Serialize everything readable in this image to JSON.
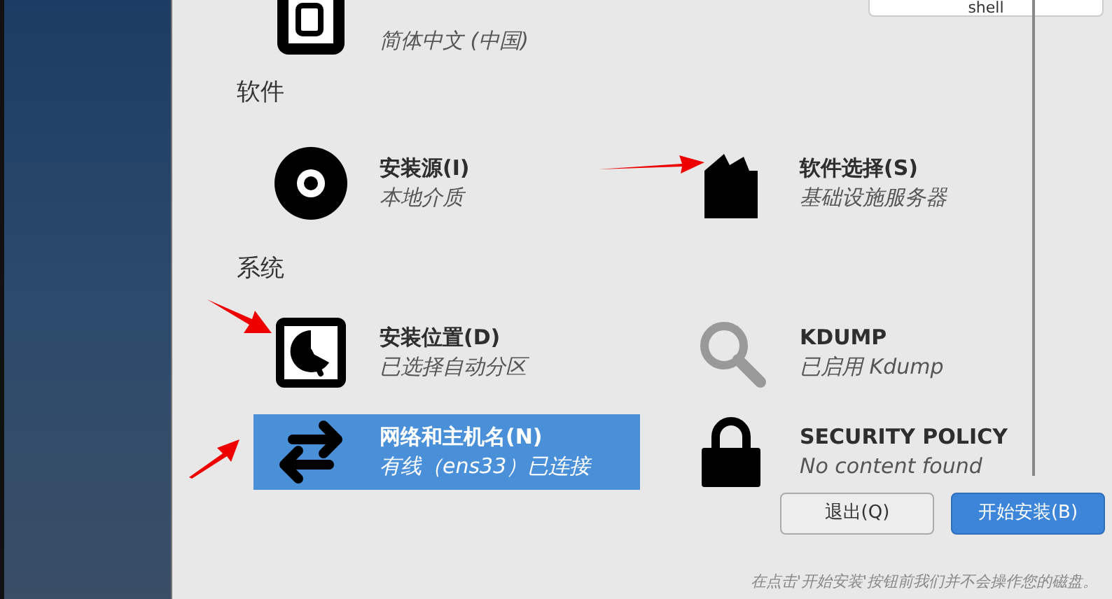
{
  "tooltip": {
    "text": "shell"
  },
  "top_item": {
    "kind": "language",
    "subtitle": "简体中文 (中国)"
  },
  "sections": [
    {
      "title": "软件",
      "items": [
        {
          "kind": "disc",
          "title": "安装源(I)",
          "subtitle": "本地介质",
          "selected": false
        },
        {
          "kind": "package",
          "title": "软件选择(S)",
          "subtitle": "基础设施服务器",
          "selected": false
        }
      ]
    },
    {
      "title": "系统",
      "items": [
        {
          "kind": "disk",
          "title": "安装位置(D)",
          "subtitle": "已选择自动分区",
          "selected": false
        },
        {
          "kind": "search",
          "title": "KDUMP",
          "subtitle": "已启用 Kdump",
          "selected": false
        },
        {
          "kind": "network",
          "title": "网络和主机名(N)",
          "subtitle": "有线（ens33）已连接",
          "selected": true
        },
        {
          "kind": "lock",
          "title": "SECURITY POLICY",
          "subtitle": "No content found",
          "selected": false
        }
      ]
    }
  ],
  "buttons": [
    {
      "label": "退出(Q)",
      "kind": "secondary"
    },
    {
      "label": "开始安装(B)",
      "kind": "primary"
    }
  ],
  "footer_note": "在点击'开始安装'按钮前我们并不会操作您的磁盘。"
}
